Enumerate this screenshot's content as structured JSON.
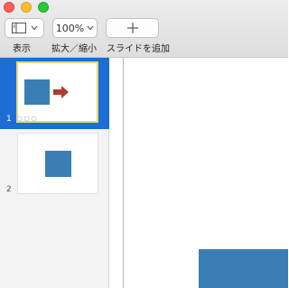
{
  "window": {
    "controls": [
      "close",
      "minimize",
      "zoom"
    ]
  },
  "toolbar": {
    "view_label": "表示",
    "zoom_value": "100%",
    "zoom_label": "拡大／縮小",
    "add_slide_label": "スライドを追加",
    "add_slide_icon": "plus-icon",
    "view_icon": "sidebar-layout-icon",
    "chevron": "⌄"
  },
  "navigator": {
    "slides": [
      {
        "number": "1",
        "selected": true,
        "content": [
          "square",
          "arrow"
        ]
      },
      {
        "number": "2",
        "selected": false,
        "content": [
          "square"
        ]
      }
    ],
    "selection_color": "#1c6ed6",
    "thumb_border_selected": "#e3d675"
  },
  "colors": {
    "shape": "#3a7fb3",
    "arrow": "#b03a2e"
  }
}
